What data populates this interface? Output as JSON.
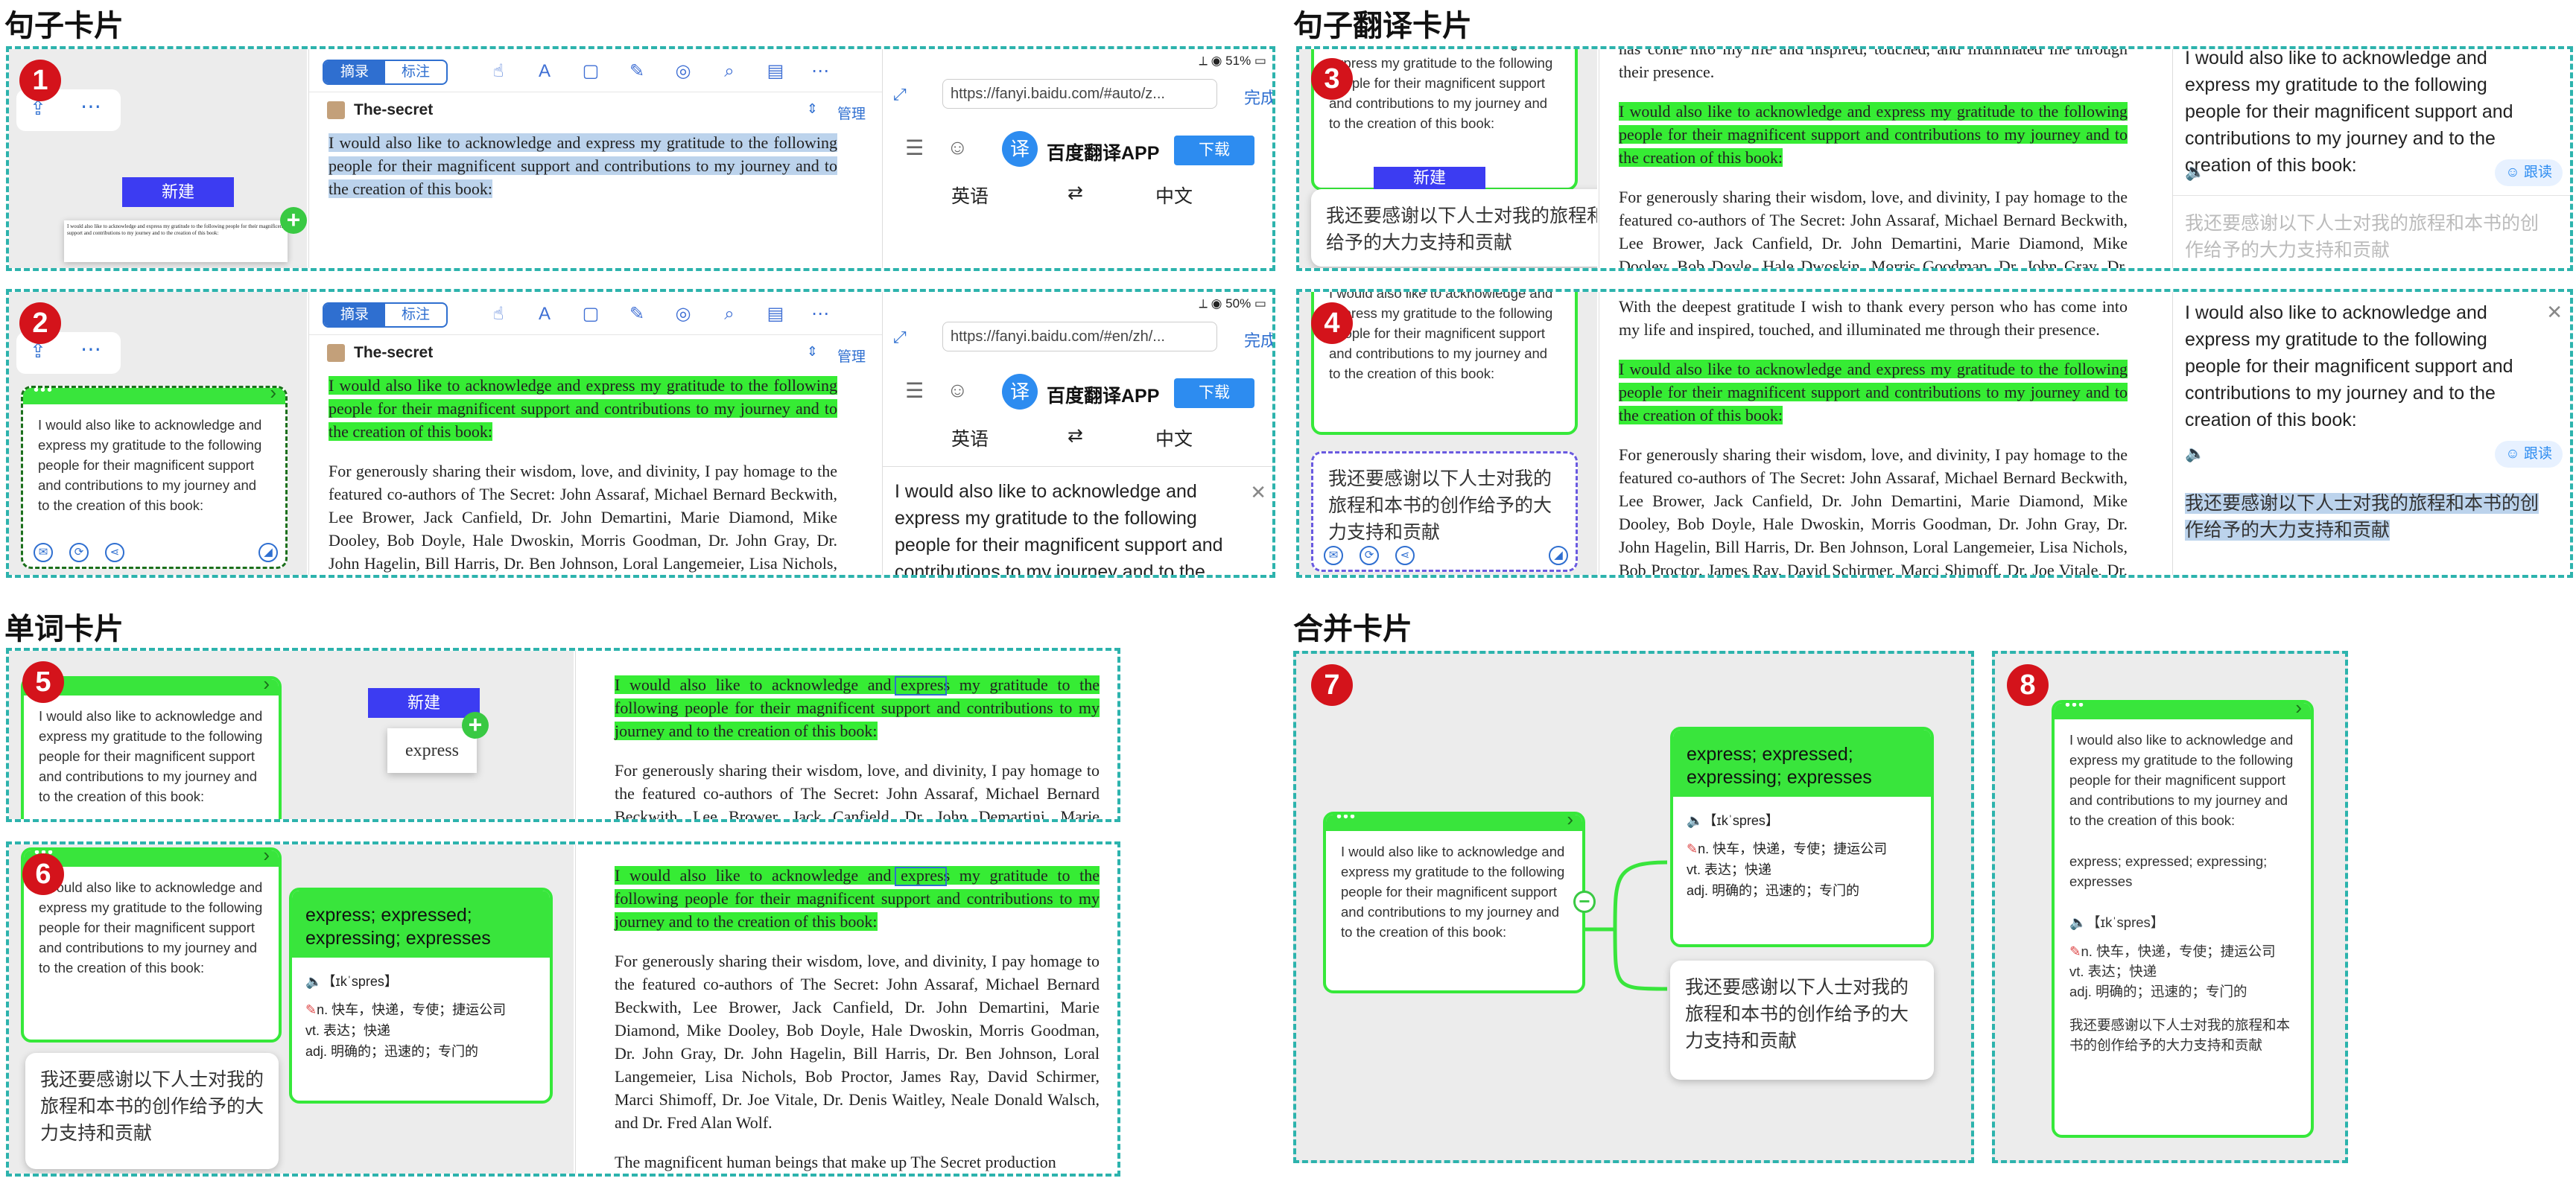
{
  "sections": {
    "sentence": "句子卡片",
    "translation": "句子翻译卡片",
    "word": "单词卡片",
    "merge": "合并卡片"
  },
  "badges": [
    "1",
    "2",
    "3",
    "4",
    "5",
    "6",
    "7",
    "8"
  ],
  "sentence_en": "I would also like to acknowledge and express my gratitude to the following people for their magnificent support and contributions to my journey and to the creation of this book:",
  "sentence_zh": "我还要感谢以下人士对我的旅程和本书的创作给予的大力支持和贡献",
  "book": {
    "title": "The-secret",
    "manage": "管理"
  },
  "toolbar": {
    "excerpt": "摘录",
    "annotate": "标注"
  },
  "new_button": "新建",
  "status1": "51%",
  "status2": "50%",
  "browser": {
    "url1": "https://fanyi.baidu.com/#auto/z...",
    "url2": "https://fanyi.baidu.com/#en/zh/...",
    "done": "完成",
    "app_name": "百度翻译APP",
    "download": "下载",
    "logo": "译",
    "src_lang": "英语",
    "dst_lang": "中文"
  },
  "follow": "跟读",
  "book_text": {
    "p_prev": "has come into my life and inspired, touched, and illuminated me through their presence.",
    "p_gratitude": "With the deepest gratitude I wish to thank every person who has come into my life and inspired, touched, and illuminated me through their presence.",
    "p2": "For generously sharing their wisdom, love, and divinity, I pay homage to the featured co-authors of The Secret: John Assaraf, Michael Bernard Beckwith, Lee Brower, Jack Canfield, Dr. John Demartini, Marie Diamond, Mike Dooley, Bob Doyle, Hale Dwoskin, Morris Goodman, Dr. John Gray, Dr. John Hagelin, Bill Harris, Dr. Ben Johnson, Loral Langemeier, Lisa Nichols, Bob Proctor, James Ray, David Schirmer, Marci Shimoff, Dr. Joe Vitale, Dr. Denis Waitley, Neale Donald Walsch, and Dr. Fred Alan Wolf.",
    "p3": "The magnificent human beings that make up The Secret production"
  },
  "word": {
    "word": "express",
    "forms": "express; expressed; expressing; expresses",
    "phonetic": "【ɪkˈspres】",
    "def1": "n. 快车，快递，专使；捷运公司",
    "def2": "vt. 表达；快递",
    "def3": "adj. 明确的；迅速的；专门的"
  }
}
